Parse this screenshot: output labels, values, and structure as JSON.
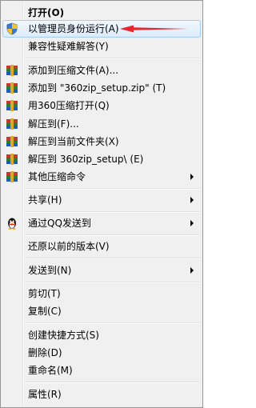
{
  "menu": {
    "open": "打开(O)",
    "run_as_admin": "以管理员身份运行(A)",
    "troubleshoot": "兼容性疑难解答(Y)",
    "add_to_archive": "添加到压缩文件(A)...",
    "add_to_zip": "添加到 \"360zip_setup.zip\" (T)",
    "open_with_360": "用360压缩打开(Q)",
    "extract_to": "解压到(F)...",
    "extract_here": "解压到当前文件夹(X)",
    "extract_to_folder": "解压到 360zip_setup\\ (E)",
    "other_commands": "其他压缩命令",
    "share": "共享(H)",
    "send_via_qq": "通过QQ发送到",
    "restore_previous": "还原以前的版本(V)",
    "send_to": "发送到(N)",
    "cut": "剪切(T)",
    "copy": "复制(C)",
    "create_shortcut": "创建快捷方式(S)",
    "delete": "删除(D)",
    "rename": "重命名(M)",
    "properties": "属性(R)"
  },
  "colors": {
    "menu_bg": "#f0f0f0",
    "highlight_border": "#a7cdf0",
    "callout_arrow": "#e8262d"
  },
  "icons": {
    "run_as_admin": "uac-shield-icon",
    "archive": "360zip-archive-icon",
    "qq": "qq-penguin-icon"
  }
}
